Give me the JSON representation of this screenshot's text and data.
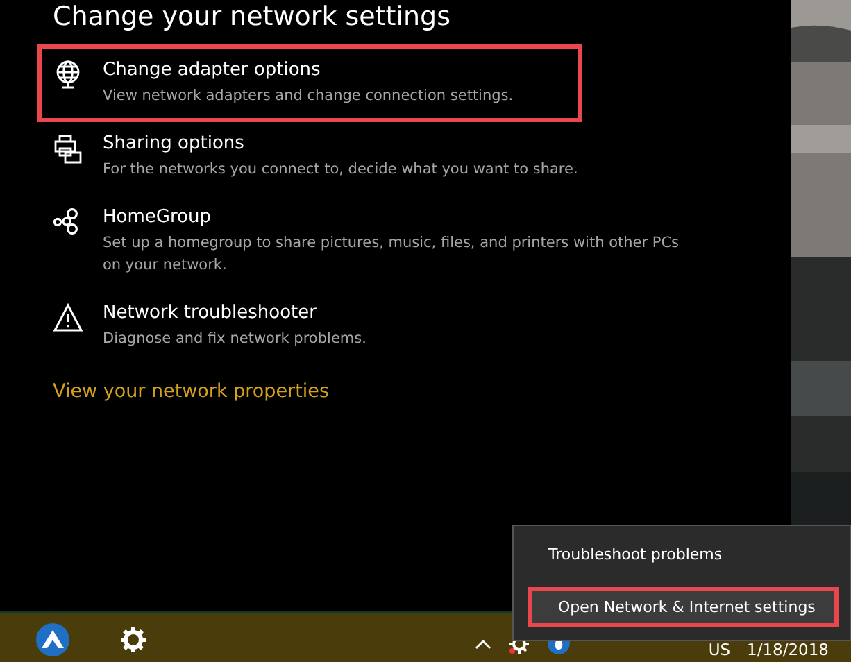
{
  "title": "Change your network settings",
  "items": [
    {
      "kind": "adapter",
      "label": "Change adapter options",
      "description": "View network adapters and change connection settings.",
      "highlighted": true
    },
    {
      "kind": "sharing",
      "label": "Sharing options",
      "description": "For the networks you connect to, decide what you want to share.",
      "highlighted": false
    },
    {
      "kind": "homegroup",
      "label": "HomeGroup",
      "description": "Set up a homegroup to share pictures, music, files, and printers with other PCs on your network.",
      "highlighted": false
    },
    {
      "kind": "troubleshooter",
      "label": "Network troubleshooter",
      "description": "Diagnose and fix network problems.",
      "highlighted": false
    }
  ],
  "link": "View your network properties",
  "context_menu": [
    {
      "label": "Troubleshoot problems",
      "highlighted": false
    },
    {
      "label": "Open Network & Internet settings",
      "highlighted": true
    }
  ],
  "tray": {
    "language": "US",
    "date": "1/18/2018"
  }
}
